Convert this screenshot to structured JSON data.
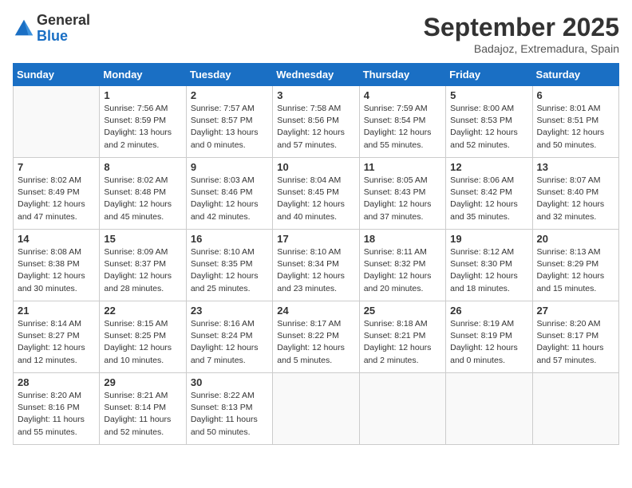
{
  "logo": {
    "general": "General",
    "blue": "Blue"
  },
  "title": "September 2025",
  "location": "Badajoz, Extremadura, Spain",
  "weekdays": [
    "Sunday",
    "Monday",
    "Tuesday",
    "Wednesday",
    "Thursday",
    "Friday",
    "Saturday"
  ],
  "weeks": [
    [
      {
        "day": "",
        "info": ""
      },
      {
        "day": "1",
        "info": "Sunrise: 7:56 AM\nSunset: 8:59 PM\nDaylight: 13 hours\nand 2 minutes."
      },
      {
        "day": "2",
        "info": "Sunrise: 7:57 AM\nSunset: 8:57 PM\nDaylight: 13 hours\nand 0 minutes."
      },
      {
        "day": "3",
        "info": "Sunrise: 7:58 AM\nSunset: 8:56 PM\nDaylight: 12 hours\nand 57 minutes."
      },
      {
        "day": "4",
        "info": "Sunrise: 7:59 AM\nSunset: 8:54 PM\nDaylight: 12 hours\nand 55 minutes."
      },
      {
        "day": "5",
        "info": "Sunrise: 8:00 AM\nSunset: 8:53 PM\nDaylight: 12 hours\nand 52 minutes."
      },
      {
        "day": "6",
        "info": "Sunrise: 8:01 AM\nSunset: 8:51 PM\nDaylight: 12 hours\nand 50 minutes."
      }
    ],
    [
      {
        "day": "7",
        "info": "Sunrise: 8:02 AM\nSunset: 8:49 PM\nDaylight: 12 hours\nand 47 minutes."
      },
      {
        "day": "8",
        "info": "Sunrise: 8:02 AM\nSunset: 8:48 PM\nDaylight: 12 hours\nand 45 minutes."
      },
      {
        "day": "9",
        "info": "Sunrise: 8:03 AM\nSunset: 8:46 PM\nDaylight: 12 hours\nand 42 minutes."
      },
      {
        "day": "10",
        "info": "Sunrise: 8:04 AM\nSunset: 8:45 PM\nDaylight: 12 hours\nand 40 minutes."
      },
      {
        "day": "11",
        "info": "Sunrise: 8:05 AM\nSunset: 8:43 PM\nDaylight: 12 hours\nand 37 minutes."
      },
      {
        "day": "12",
        "info": "Sunrise: 8:06 AM\nSunset: 8:42 PM\nDaylight: 12 hours\nand 35 minutes."
      },
      {
        "day": "13",
        "info": "Sunrise: 8:07 AM\nSunset: 8:40 PM\nDaylight: 12 hours\nand 32 minutes."
      }
    ],
    [
      {
        "day": "14",
        "info": "Sunrise: 8:08 AM\nSunset: 8:38 PM\nDaylight: 12 hours\nand 30 minutes."
      },
      {
        "day": "15",
        "info": "Sunrise: 8:09 AM\nSunset: 8:37 PM\nDaylight: 12 hours\nand 28 minutes."
      },
      {
        "day": "16",
        "info": "Sunrise: 8:10 AM\nSunset: 8:35 PM\nDaylight: 12 hours\nand 25 minutes."
      },
      {
        "day": "17",
        "info": "Sunrise: 8:10 AM\nSunset: 8:34 PM\nDaylight: 12 hours\nand 23 minutes."
      },
      {
        "day": "18",
        "info": "Sunrise: 8:11 AM\nSunset: 8:32 PM\nDaylight: 12 hours\nand 20 minutes."
      },
      {
        "day": "19",
        "info": "Sunrise: 8:12 AM\nSunset: 8:30 PM\nDaylight: 12 hours\nand 18 minutes."
      },
      {
        "day": "20",
        "info": "Sunrise: 8:13 AM\nSunset: 8:29 PM\nDaylight: 12 hours\nand 15 minutes."
      }
    ],
    [
      {
        "day": "21",
        "info": "Sunrise: 8:14 AM\nSunset: 8:27 PM\nDaylight: 12 hours\nand 12 minutes."
      },
      {
        "day": "22",
        "info": "Sunrise: 8:15 AM\nSunset: 8:25 PM\nDaylight: 12 hours\nand 10 minutes."
      },
      {
        "day": "23",
        "info": "Sunrise: 8:16 AM\nSunset: 8:24 PM\nDaylight: 12 hours\nand 7 minutes."
      },
      {
        "day": "24",
        "info": "Sunrise: 8:17 AM\nSunset: 8:22 PM\nDaylight: 12 hours\nand 5 minutes."
      },
      {
        "day": "25",
        "info": "Sunrise: 8:18 AM\nSunset: 8:21 PM\nDaylight: 12 hours\nand 2 minutes."
      },
      {
        "day": "26",
        "info": "Sunrise: 8:19 AM\nSunset: 8:19 PM\nDaylight: 12 hours\nand 0 minutes."
      },
      {
        "day": "27",
        "info": "Sunrise: 8:20 AM\nSunset: 8:17 PM\nDaylight: 11 hours\nand 57 minutes."
      }
    ],
    [
      {
        "day": "28",
        "info": "Sunrise: 8:20 AM\nSunset: 8:16 PM\nDaylight: 11 hours\nand 55 minutes."
      },
      {
        "day": "29",
        "info": "Sunrise: 8:21 AM\nSunset: 8:14 PM\nDaylight: 11 hours\nand 52 minutes."
      },
      {
        "day": "30",
        "info": "Sunrise: 8:22 AM\nSunset: 8:13 PM\nDaylight: 11 hours\nand 50 minutes."
      },
      {
        "day": "",
        "info": ""
      },
      {
        "day": "",
        "info": ""
      },
      {
        "day": "",
        "info": ""
      },
      {
        "day": "",
        "info": ""
      }
    ]
  ]
}
